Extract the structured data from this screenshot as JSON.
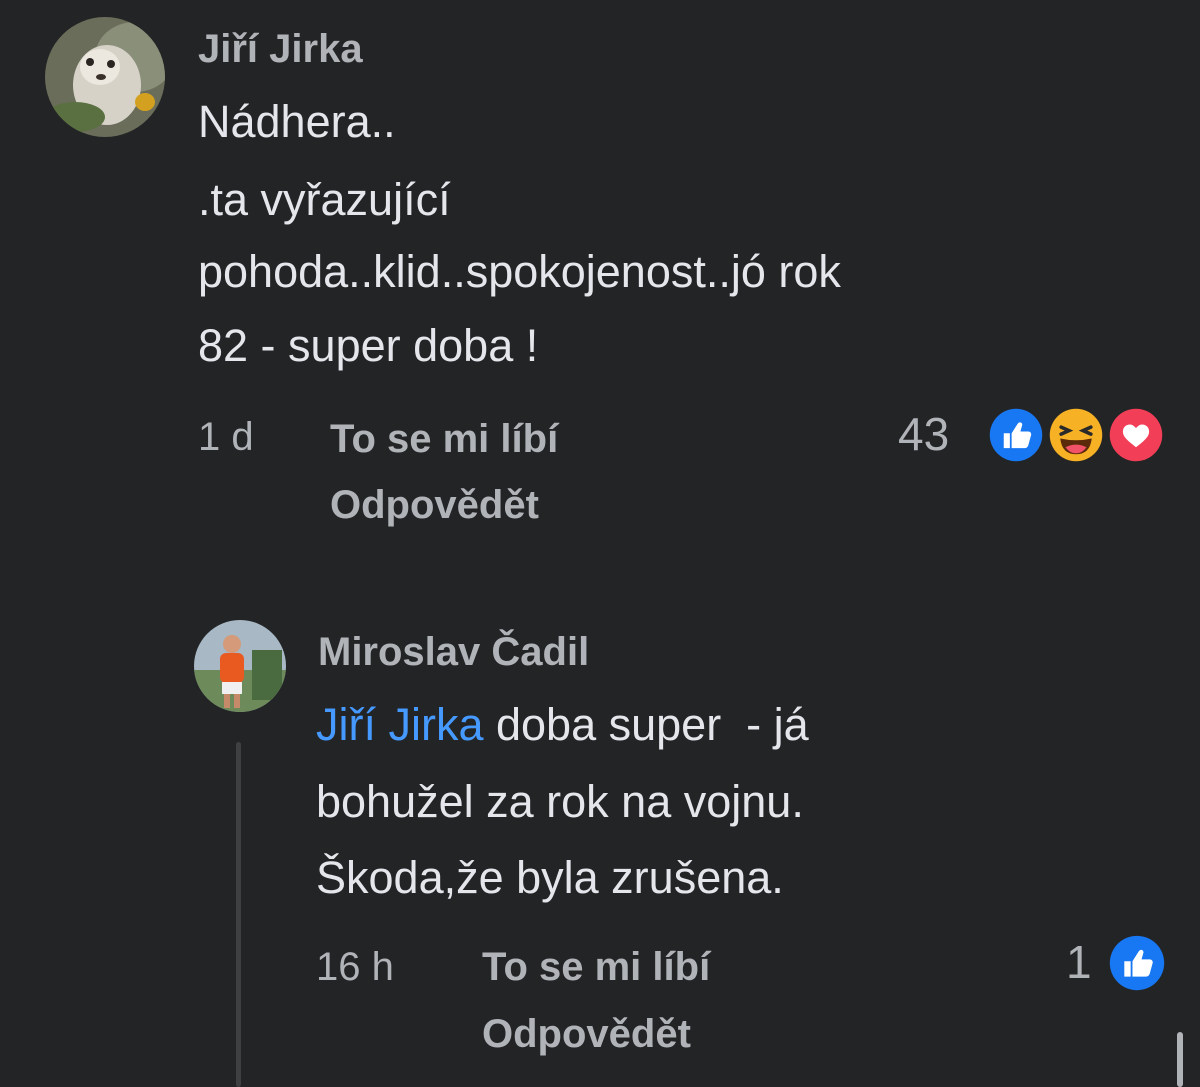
{
  "comment": {
    "author": "Jiří Jirka",
    "lines": [
      "Nádhera..",
      ".ta vyřazující",
      "pohoda..klid..spokojenost..jó rok",
      "82 - super doba !"
    ],
    "time": "1 d",
    "like_label": "To se mi líbí",
    "reply_label": "Odpovědět",
    "reaction_count": "43",
    "reactions": [
      "like-icon",
      "haha-icon",
      "love-icon"
    ]
  },
  "reply": {
    "author": "Miroslav Čadil",
    "mention": "Jiří Jirka",
    "lines": [
      " doba super  - já",
      "bohužel za rok na vojnu.",
      "Škoda,že byla zrušena."
    ],
    "time": "16 h",
    "like_label": "To se mi líbí",
    "reply_label": "Odpovědět",
    "reaction_count": "1",
    "reactions": [
      "like-icon"
    ]
  },
  "colors": {
    "background": "#232425",
    "text_primary": "#e4e6eb",
    "text_secondary": "#b0b3b8",
    "mention": "#4599ff",
    "like_blue": "#1877f2",
    "love_red": "#f33e58",
    "haha_yellow": "#f7b125"
  }
}
